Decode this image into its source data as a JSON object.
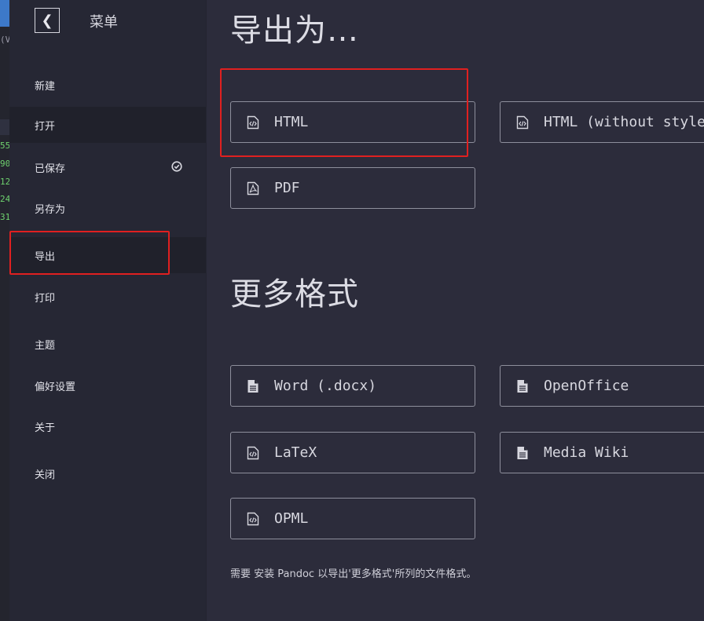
{
  "editor_edge": {
    "line_numbers": [
      "55",
      "90",
      "12",
      "24",
      "31"
    ],
    "marker": "(V"
  },
  "sidebar": {
    "back_icon": "chevron-left-icon",
    "title": "菜单",
    "items": [
      {
        "label": "新建"
      },
      {
        "label": "打开"
      },
      {
        "label": "已保存",
        "icon": "check-circle-icon"
      },
      {
        "label": "另存为"
      },
      {
        "label": "导出"
      },
      {
        "label": "打印"
      },
      {
        "label": "主题"
      },
      {
        "label": "偏好设置"
      },
      {
        "label": "关于"
      },
      {
        "label": "关闭"
      }
    ]
  },
  "main": {
    "export_heading": "导出为…",
    "export_options": [
      {
        "label": "HTML",
        "icon": "code-file-icon"
      },
      {
        "label": "HTML (without styles)",
        "icon": "code-file-icon"
      },
      {
        "label": "PDF",
        "icon": "pdf-file-icon"
      }
    ],
    "more_heading": "更多格式",
    "more_options": [
      {
        "label": "Word (.docx)",
        "icon": "document-file-icon"
      },
      {
        "label": "OpenOffice",
        "icon": "document-file-icon"
      },
      {
        "label": "LaTeX",
        "icon": "code-file-icon"
      },
      {
        "label": "Media Wiki",
        "icon": "document-file-icon"
      },
      {
        "label": "OPML",
        "icon": "code-file-icon"
      }
    ],
    "footnote": "需要 安装 Pandoc 以导出'更多格式'所列的文件格式。"
  },
  "colors": {
    "highlight_box": "#e02020",
    "background": "#2c2c3b",
    "sidebar": "#262734"
  }
}
